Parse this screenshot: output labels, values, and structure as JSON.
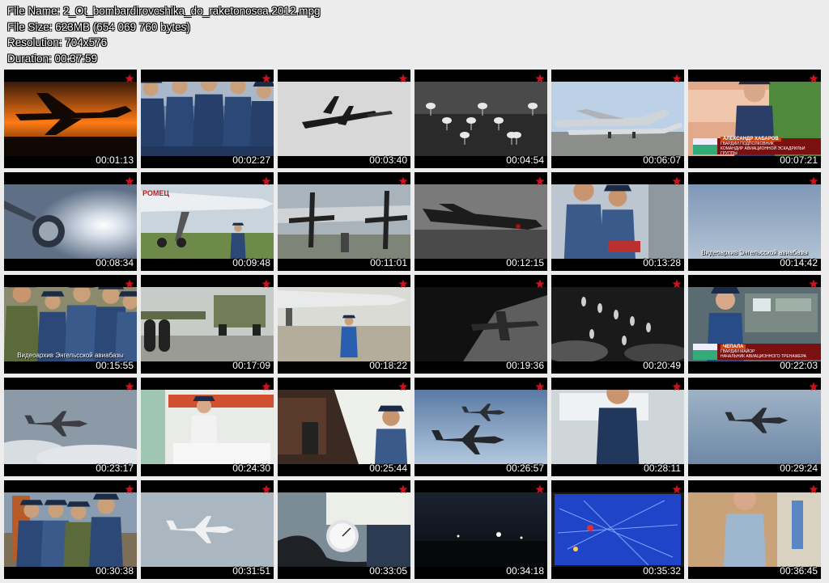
{
  "file_info": {
    "name": "File Name: 2_Ot_bombardirovcshika_do_raketonosca.2012.mpg",
    "size": "File Size: 623MB (654 069 760 bytes)",
    "resolution": "Resolution: 704x576",
    "duration": "Duration: 00:37:59"
  },
  "colors": {
    "star": "#d0101a",
    "background": "#ececec",
    "tile": "#000000"
  },
  "thumbnails": [
    {
      "time": "00:01:13",
      "scene": "sunset-silhouette"
    },
    {
      "time": "00:02:27",
      "scene": "soldiers"
    },
    {
      "time": "00:03:40",
      "scene": "biplane"
    },
    {
      "time": "00:04:54",
      "scene": "parachutes"
    },
    {
      "time": "00:06:07",
      "scene": "bombers-airfield"
    },
    {
      "time": "00:07:21",
      "scene": "interview-pilot",
      "lower_third": {
        "name": "АЛЕКСАНДР ХАБАРОВ",
        "title": "ГВАРДИИ ПОДПОЛКОВНИК",
        "sub": "КОМАНДИР АВИАЦИОННОЙ ЭСКАДРИЛЬИ ГРУППЫ"
      }
    },
    {
      "time": "00:08:34",
      "scene": "refuel-flash"
    },
    {
      "time": "00:09:48",
      "scene": "kremlin-nose",
      "label": "РОМЕЦ"
    },
    {
      "time": "00:11:01",
      "scene": "propellers"
    },
    {
      "time": "00:12:15",
      "scene": "bw-bomber"
    },
    {
      "time": "00:13:28",
      "scene": "pilots-map"
    },
    {
      "time": "00:14:42",
      "scene": "sky",
      "caption": "Видеоархив Энгельсской авиабазы"
    },
    {
      "time": "00:15:55",
      "scene": "officers-crowd",
      "caption": "Видеоархив Энгельсской авиабазы"
    },
    {
      "time": "00:17:09",
      "scene": "landing-gear"
    },
    {
      "time": "00:18:22",
      "scene": "airman-walking"
    },
    {
      "time": "00:19:36",
      "scene": "bw-cockpit-plane"
    },
    {
      "time": "00:20:49",
      "scene": "bw-bombs"
    },
    {
      "time": "00:22:03",
      "scene": "control-room",
      "lower_third": {
        "name": "ЧЕПАЛА",
        "title": "ГВАРДИИ МАЙОР",
        "sub": "НАЧАЛЬНИК АВИАЦИОННОГО ТРЕНАЖЕРА"
      }
    },
    {
      "time": "00:23:17",
      "scene": "above-clouds"
    },
    {
      "time": "00:24:30",
      "scene": "canteen"
    },
    {
      "time": "00:25:44",
      "scene": "medic"
    },
    {
      "time": "00:26:57",
      "scene": "jets-pair"
    },
    {
      "time": "00:28:11",
      "scene": "officer-desk"
    },
    {
      "time": "00:29:24",
      "scene": "jet-sky"
    },
    {
      "time": "00:30:38",
      "scene": "crew-ground"
    },
    {
      "time": "00:31:51",
      "scene": "jet-haze"
    },
    {
      "time": "00:33:05",
      "scene": "blood-pressure"
    },
    {
      "time": "00:34:18",
      "scene": "night-lights"
    },
    {
      "time": "00:35:32",
      "scene": "radar-map"
    },
    {
      "time": "00:36:45",
      "scene": "interview-officer"
    }
  ]
}
